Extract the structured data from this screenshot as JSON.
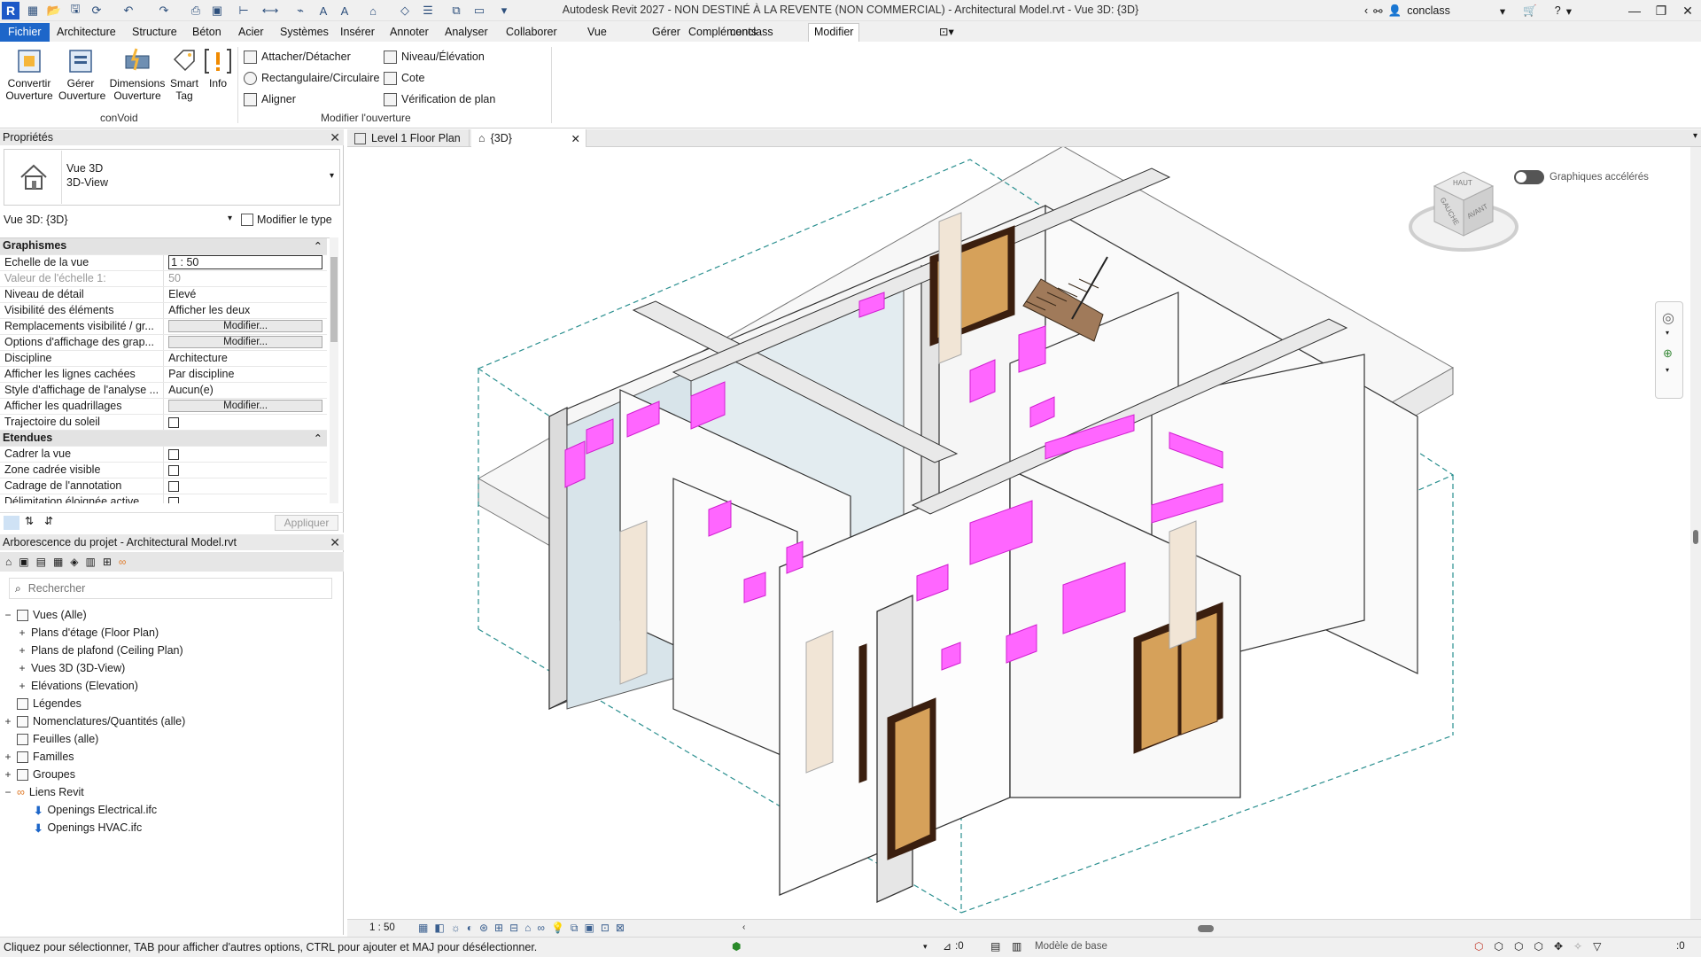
{
  "window": {
    "title": "Autodesk Revit 2027 - NON DESTINÉ À LA REVENTE (NON COMMERCIAL) - Architectural Model.rvt - Vue 3D: {3D}",
    "user": "conclass",
    "logo": "R"
  },
  "menu": {
    "tabs": [
      "Fichier",
      "Architecture",
      "Structure",
      "Béton",
      "Acier",
      "Systèmes",
      "Insérer",
      "Annoter",
      "Analyser",
      "Collaborer",
      "Vue",
      "Gérer",
      "Compléments",
      "conclass",
      "Modifier"
    ],
    "active": "conclass"
  },
  "ribbon": {
    "convoid": {
      "label": "conVoid",
      "buttons": [
        {
          "line1": "Convertir",
          "line2": "Ouverture"
        },
        {
          "line1": "Gérer",
          "line2": "Ouverture"
        },
        {
          "line1": "Dimensions",
          "line2": "Ouverture"
        },
        {
          "line1": "Smart",
          "line2": "Tag"
        },
        {
          "line1": "Info",
          "line2": ""
        }
      ]
    },
    "modify": {
      "label": "Modifier l'ouverture",
      "col1": [
        "Attacher/Détacher",
        "Rectangulaire/Circulaire",
        "Aligner"
      ],
      "col2": [
        "Niveau/Élévation",
        "Cote",
        "Vérification de plan"
      ]
    }
  },
  "properties": {
    "title": "Propriétés",
    "type_name": "Vue 3D",
    "type_sub": "3D-View",
    "instance": "Vue 3D: {3D}",
    "edit_type": "Modifier le type",
    "apply": "Appliquer",
    "sections": [
      {
        "name": "Graphismes",
        "rows": [
          {
            "k": "Echelle de la vue",
            "v": "1 : 50",
            "kind": "input"
          },
          {
            "k": "Valeur de l'échelle    1:",
            "v": "50",
            "kind": "disabled"
          },
          {
            "k": "Niveau de détail",
            "v": "Elevé",
            "kind": "text"
          },
          {
            "k": "Visibilité des éléments",
            "v": "Afficher les deux",
            "kind": "text"
          },
          {
            "k": "Remplacements visibilité / gr...",
            "v": "Modifier...",
            "kind": "button"
          },
          {
            "k": "Options d'affichage des grap...",
            "v": "Modifier...",
            "kind": "button"
          },
          {
            "k": "Discipline",
            "v": "Architecture",
            "kind": "text"
          },
          {
            "k": "Afficher les lignes cachées",
            "v": "Par discipline",
            "kind": "text"
          },
          {
            "k": "Style d'affichage de l'analyse ...",
            "v": "Aucun(e)",
            "kind": "text"
          },
          {
            "k": "Afficher les quadrillages",
            "v": "Modifier...",
            "kind": "button"
          },
          {
            "k": "Trajectoire du soleil",
            "v": "",
            "kind": "check"
          }
        ]
      },
      {
        "name": "Etendues",
        "rows": [
          {
            "k": "Cadrer la vue",
            "v": "",
            "kind": "check"
          },
          {
            "k": "Zone cadrée visible",
            "v": "",
            "kind": "check"
          },
          {
            "k": "Cadrage de l'annotation",
            "v": "",
            "kind": "check"
          },
          {
            "k": "Délimitation éloignée active",
            "v": "",
            "kind": "check"
          }
        ]
      }
    ]
  },
  "browser": {
    "title": "Arborescence du projet - Architectural Model.rvt",
    "search_placeholder": "Rechercher",
    "items": [
      {
        "label": "Vues (Alle)",
        "level": 0,
        "exp": "−"
      },
      {
        "label": "Plans d'étage (Floor Plan)",
        "level": 1,
        "exp": "+"
      },
      {
        "label": "Plans de plafond (Ceiling Plan)",
        "level": 1,
        "exp": "+"
      },
      {
        "label": "Vues 3D (3D-View)",
        "level": 1,
        "exp": "+"
      },
      {
        "label": "Elévations (Elevation)",
        "level": 1,
        "exp": "+"
      },
      {
        "label": "Légendes",
        "level": 0,
        "exp": ""
      },
      {
        "label": "Nomenclatures/Quantités (alle)",
        "level": 0,
        "exp": "+"
      },
      {
        "label": "Feuilles (alle)",
        "level": 0,
        "exp": ""
      },
      {
        "label": "Familles",
        "level": 0,
        "exp": "+"
      },
      {
        "label": "Groupes",
        "level": 0,
        "exp": "+"
      },
      {
        "label": "Liens Revit",
        "level": 0,
        "exp": "−"
      },
      {
        "label": "Openings Electrical.ifc",
        "level": 2,
        "exp": ""
      },
      {
        "label": "Openings HVAC.ifc",
        "level": 2,
        "exp": ""
      }
    ]
  },
  "view_tabs": [
    {
      "label": "Level 1 Floor Plan",
      "active": false
    },
    {
      "label": "{3D}",
      "active": true
    }
  ],
  "viewport": {
    "accel_label": "Graphiques accélérés",
    "viewcube": {
      "top": "HAUT",
      "left": "GAUCHE",
      "front": "AVANT"
    },
    "colors": {
      "opening": "#ff66ff",
      "door": "#d6a15a",
      "door_frame": "#3b1f0f",
      "section_box": "#2a8f8f"
    }
  },
  "view_control": {
    "scale": "1 : 50"
  },
  "status": {
    "text": "Cliquez pour sélectionner, TAB pour afficher d'autres options,  CTRL pour ajouter et MAJ pour désélectionner.",
    "zero1": ":0",
    "model": "Modèle de base",
    "zero2": ":0"
  }
}
